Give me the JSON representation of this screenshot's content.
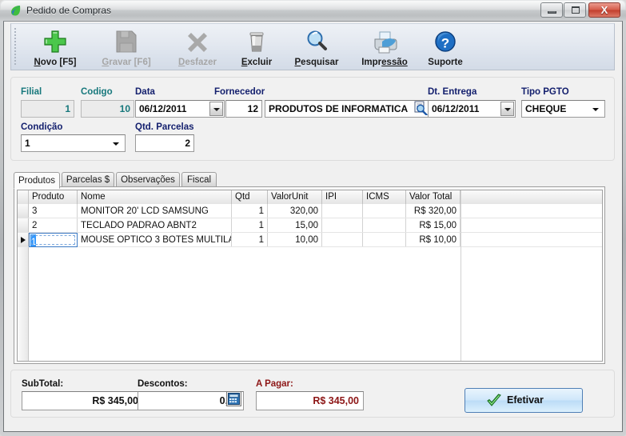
{
  "window": {
    "title": "Pedido de Compras",
    "icon": "app-leaf-icon",
    "buttons": {
      "minimize": "minimize-icon",
      "maximize": "maximize-icon",
      "close": "X"
    }
  },
  "toolbar": {
    "items": [
      {
        "id": "novo",
        "label_pre": "N",
        "label_post": "ovo [F5]",
        "icon": "plus-icon",
        "enabled": true
      },
      {
        "id": "gravar",
        "label_pre": "G",
        "label_post": "ravar [F6]",
        "icon": "save-disk-icon",
        "enabled": false
      },
      {
        "id": "desfazer",
        "label_pre": "D",
        "label_post": "esfazer",
        "icon": "x-cross-icon",
        "enabled": false
      },
      {
        "id": "excluir",
        "label_pre": "E",
        "label_post": "xcluir",
        "icon": "trash-can-icon",
        "enabled": true
      },
      {
        "id": "pesquisar",
        "label_pre": "P",
        "label_post": "esquisar",
        "icon": "magnifier-icon",
        "enabled": true
      },
      {
        "id": "impressao",
        "label_pre": "Impr",
        "label_post": "essão",
        "icon": "printer-icon",
        "enabled": true
      },
      {
        "id": "suporte",
        "label_pre": "S",
        "label_post": "uporte",
        "icon": "help-question-icon",
        "enabled": true
      }
    ]
  },
  "form": {
    "filial": {
      "label": "Filial",
      "value": "1",
      "readonly": true
    },
    "codigo": {
      "label": "Codigo",
      "value": "10",
      "readonly": true
    },
    "data": {
      "label": "Data",
      "value": "06/12/2011"
    },
    "fornecedor": {
      "label": "Fornecedor",
      "code": "12",
      "name": "PRODUTOS DE INFORMATICA",
      "search_icon": "magnifier-search-icon"
    },
    "dt_entrega": {
      "label": "Dt. Entrega",
      "value": "06/12/2011"
    },
    "tipo_pgto": {
      "label": "Tipo PGTO",
      "value": "CHEQUE"
    },
    "condicao": {
      "label": "Condição",
      "value": "1"
    },
    "qtd_parcelas": {
      "label": "Qtd. Parcelas",
      "value": "2"
    }
  },
  "tabs": [
    {
      "label": "Produtos",
      "active": true
    },
    {
      "label": "Parcelas $",
      "active": false
    },
    {
      "label": "Observações",
      "active": false
    },
    {
      "label": "Fiscal",
      "active": false
    }
  ],
  "grid": {
    "columns": [
      "Produto",
      "Nome",
      "Qtd",
      "ValorUnit",
      "IPI",
      "ICMS",
      "Valor Total"
    ],
    "rows": [
      {
        "produto": "3",
        "nome": "MONITOR 20' LCD SAMSUNG",
        "qtd": "1",
        "valor_unit": "320,00",
        "ipi": "",
        "icms": "",
        "valor_total": "R$ 320,00",
        "selected": false
      },
      {
        "produto": "2",
        "nome": "TECLADO PADRAO ABNT2",
        "qtd": "1",
        "valor_unit": "15,00",
        "ipi": "",
        "icms": "",
        "valor_total": "R$ 15,00",
        "selected": false
      },
      {
        "produto": "1",
        "nome": "MOUSE OPTICO 3 BOTES MULTILA",
        "qtd": "1",
        "valor_unit": "10,00",
        "ipi": "",
        "icms": "",
        "valor_total": "R$ 10,00",
        "selected": true
      }
    ],
    "editing_cell_value": "1"
  },
  "totals": {
    "subtotal": {
      "label": "SubTotal:",
      "value": "R$ 345,00"
    },
    "descontos": {
      "label": "Descontos:",
      "value": "0,00",
      "calc_icon": "calculator-icon"
    },
    "a_pagar": {
      "label": "A Pagar:",
      "value": "R$ 345,00"
    },
    "confirm": {
      "label": "Efetivar",
      "icon": "green-check-icon"
    }
  },
  "colors": {
    "label_teal": "#17787c",
    "label_navy": "#14206e",
    "accent_red": "#8d1616",
    "selection_blue": "#3399ff",
    "close_red": "#c3402f"
  }
}
